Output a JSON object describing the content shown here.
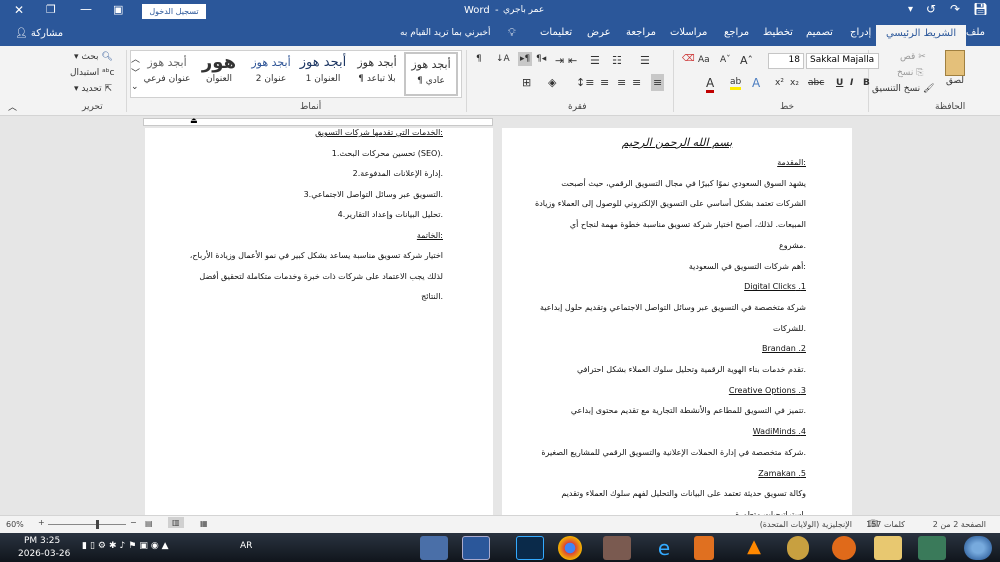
{
  "title": {
    "doc": "عمر باجري",
    "app": "Word",
    "separator": "-",
    "signin": "تسجيل الدخول"
  },
  "tabs": [
    "ملف",
    "الشريط الرئيسي",
    "إدراج",
    "تصميم",
    "تخطيط",
    "مراجع",
    "مراسلات",
    "مراجعة",
    "عرض",
    "تعليمات"
  ],
  "tell_me": "أخبرني بما تريد القيام به",
  "share": "مشاركة",
  "clipboard": {
    "paste": "لصق",
    "cut": "قص",
    "copy": "نسخ",
    "format_painter": "نسخ التنسيق",
    "label": "الحافظة"
  },
  "font": {
    "name": "Sakkal Majalla",
    "size": "18",
    "label": "خط",
    "bold": "B",
    "italic": "I",
    "underline": "U",
    "strike": "abc",
    "sub": "x₂",
    "sup": "x²",
    "case": "Aa"
  },
  "paragraph": {
    "label": "فقرة"
  },
  "styles": {
    "label": "أنماط",
    "items": [
      {
        "preview": "أبجد هوز",
        "name": "¶ عادي"
      },
      {
        "preview": "أبجد هوز",
        "name": "¶ بلا تباعد"
      },
      {
        "preview": "أبجد هوز",
        "name": "العنوان 1"
      },
      {
        "preview": "أبجد هوز",
        "name": "عنوان 2"
      },
      {
        "preview": "هور",
        "name": "العنوان"
      },
      {
        "preview": "أبجد هوز",
        "name": "عنوان فرعي"
      }
    ]
  },
  "editing": {
    "find": "بحث",
    "replace": "استبدال",
    "select": "تحديد",
    "label": "تحرير"
  },
  "page1": {
    "basmala": "بسم الله الرحمن الرحيم",
    "lines": [
      {
        "t": ":المقدمة",
        "u": true
      },
      {
        "t": "يشهد السوق السعودي نموًا كبيرًا في مجال التسويق الرقمي، حيث أصبحت"
      },
      {
        "t": "الشركات تعتمد بشكل أساسي على التسويق الإلكتروني للوصول إلى العملاء وزيادة"
      },
      {
        "t": "المبيعات. لذلك، أصبح اختيار شركة تسويق مناسبة خطوة مهمة لنجاح أي"
      },
      {
        "t": ".مشروع"
      },
      {
        "t": ":أهم شركات التسويق في السعودية"
      },
      {
        "t": "1. Digital Clicks",
        "u": true
      },
      {
        "t": "شركة متخصصة في التسويق عبر وسائل التواصل الاجتماعي وتقديم حلول إبداعية"
      },
      {
        "t": ".للشركات"
      },
      {
        "t": "2. Brandan",
        "u": true
      },
      {
        "t": ".تقدم خدمات بناء الهوية الرقمية وتحليل سلوك العملاء بشكل احترافي"
      },
      {
        "t": "3. Creative Options",
        "u": true
      },
      {
        "t": ".تتميز في التسويق للمطاعم والأنشطة التجارية مع تقديم محتوى إبداعي"
      },
      {
        "t": "4. WadiMinds",
        "u": true
      },
      {
        "t": ".شركة متخصصة في إدارة الحملات الإعلانية والتسويق الرقمي للمشاريع الصغيرة"
      },
      {
        "t": "5. Zamakan",
        "u": true
      },
      {
        "t": "وكالة تسويق حديثة تعتمد على البيانات والتحليل لفهم سلوك العملاء وتقديم"
      },
      {
        "t": ".استراتيجيات متطورة"
      }
    ]
  },
  "page2": {
    "lines": [
      {
        "t": ":الخدمات التي تقدمها شركات التسويق",
        "u": true
      },
      {
        "t": ".(SEO) تحسين محركات البحث.1"
      },
      {
        "t": ".إدارة الإعلانات المدفوعة.2"
      },
      {
        "t": ".التسويق عبر وسائل التواصل الاجتماعي.3"
      },
      {
        "t": ".تحليل البيانات وإعداد التقارير.4"
      },
      {
        "t": ":الخاتمة",
        "u": true
      },
      {
        "t": "اختيار شركة تسويق مناسبة يساعد بشكل كبير في نمو الأعمال وزيادة الأرباح،"
      },
      {
        "t": "لذلك يجب الاعتماد على شركات ذات خبرة وخدمات متكاملة لتحقيق أفضل"
      },
      {
        "t": ".النتائج"
      }
    ]
  },
  "status": {
    "page": "الصفحة 2 من 2",
    "words": "157 كلمات",
    "language": "الإنجليزية (الولايات المتحدة)",
    "zoom": "60%"
  },
  "taskbar": {
    "time": "PM 3:25",
    "date": "2026-03-26",
    "lang": "AR"
  }
}
